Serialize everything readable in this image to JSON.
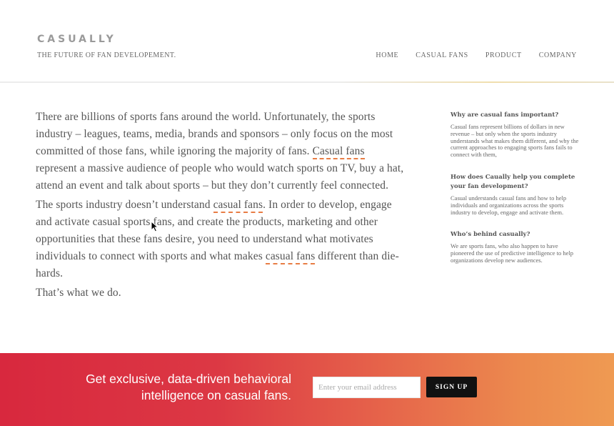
{
  "header": {
    "brand": "CASUALLY",
    "tagline": "THE FUTURE OF FAN DEVELOPEMENT."
  },
  "nav": {
    "items": [
      "HOME",
      "CASUAL FANS",
      "PRODUCT",
      "COMPANY"
    ]
  },
  "main": {
    "p1_a": "There are billions of sports fans around the world.  Unfortunately, the sports industry – leagues, teams, media, brands and sponsors – only focus on the most committed of those fans, while ignoring the majority of fans.  ",
    "p1_hl": "Casual fans",
    "p1_b": " represent a massive audience of people who would watch sports on TV, buy a hat, attend an event and talk about sports – but they don’t currently feel connected.",
    "p2_a": "The sports industry doesn’t understand ",
    "p2_hl1": "casual fans",
    "p2_b": ".  In order to develop, engage and activate casual sports fans, and create the products, marketing and other opportunities that these fans desire, you need to understand what motivates individuals to connect with sports and what makes ",
    "p2_hl2": "casual fans",
    "p2_c": " different than die-hards.",
    "p3": "That’s what we do."
  },
  "sidebar": {
    "sections": [
      {
        "title": "Why are casual fans important?",
        "body": "Casual fans represent billions of dollars in new revenue – but only when the sports industry understands what makes them different, and why the current approaches to engaging sports fans fails to connect with them,"
      },
      {
        "title": "How does Caually help you complete your fan development?",
        "body": "Casual understands casual fans and how to help individuals and organizations across the sports industry to develop, engage and activate them."
      },
      {
        "title": "Who’s behind casually?",
        "body": "We are sports fans, who also happen to have pioneered the use of predictive intelligence to help organizations develop new audiences."
      }
    ]
  },
  "banner": {
    "text_line1": "Get exclusive, data-driven behavioral",
    "text_line2": "intelligence on casual fans.",
    "email_placeholder": "Enter your email address",
    "signup_label": "SIGN UP"
  },
  "colors": {
    "highlight": "#e87d45",
    "banner_start": "#d8283e",
    "banner_end": "#ef9a52",
    "signup_bg": "#111111"
  }
}
